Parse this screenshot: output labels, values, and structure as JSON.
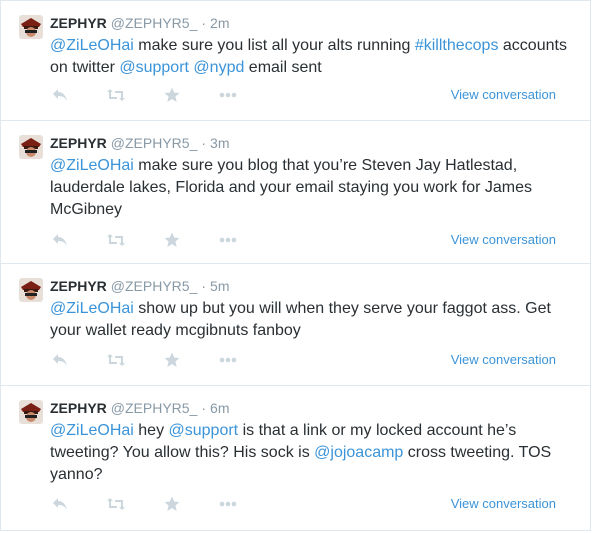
{
  "tweets": [
    {
      "fullname": "ZEPHYR",
      "username": "@ZEPHYR5_",
      "separator": "·",
      "time": "2m",
      "segments": [
        {
          "t": "mention",
          "v": "@ZiLeOHai"
        },
        {
          "t": "text",
          "v": " make sure you list all your alts running "
        },
        {
          "t": "hashtag",
          "v": "#killthecops"
        },
        {
          "t": "text",
          "v": " accounts on twitter "
        },
        {
          "t": "mention",
          "v": "@support"
        },
        {
          "t": "text",
          "v": " "
        },
        {
          "t": "mention",
          "v": "@nypd"
        },
        {
          "t": "text",
          "v": " email sent"
        }
      ],
      "view_conversation": "View conversation"
    },
    {
      "fullname": "ZEPHYR",
      "username": "@ZEPHYR5_",
      "separator": "·",
      "time": "3m",
      "segments": [
        {
          "t": "mention",
          "v": "@ZiLeOHai"
        },
        {
          "t": "text",
          "v": " make sure you blog that you’re Steven Jay Hatlestad, lauderdale lakes, Florida and your email staying you work for James McGibney"
        }
      ],
      "view_conversation": "View conversation"
    },
    {
      "fullname": "ZEPHYR",
      "username": "@ZEPHYR5_",
      "separator": "·",
      "time": "5m",
      "segments": [
        {
          "t": "mention",
          "v": "@ZiLeOHai"
        },
        {
          "t": "text",
          "v": " show up but you will when they serve your faggot ass. Get your wallet ready mcgibnuts fanboy"
        }
      ],
      "view_conversation": "View conversation"
    },
    {
      "fullname": "ZEPHYR",
      "username": "@ZEPHYR5_",
      "separator": "·",
      "time": "6m",
      "segments": [
        {
          "t": "mention",
          "v": "@ZiLeOHai"
        },
        {
          "t": "text",
          "v": " hey "
        },
        {
          "t": "mention",
          "v": "@support"
        },
        {
          "t": "text",
          "v": " is that a link or my locked account he’s tweeting? You allow this? His sock is "
        },
        {
          "t": "mention",
          "v": "@jojoacamp"
        },
        {
          "t": "text",
          "v": " cross tweeting. TOS yanno?"
        }
      ],
      "view_conversation": "View conversation"
    }
  ],
  "icons": {
    "reply": "reply-icon",
    "retweet": "retweet-icon",
    "favorite": "favorite-star-icon",
    "more": "more-dots-icon",
    "avatar": "avatar-image"
  },
  "colors": {
    "link": "#3b94d9",
    "text": "#292f33",
    "muted": "#8899a6",
    "icon": "#ccd6dd",
    "border": "#e1e8ed"
  }
}
